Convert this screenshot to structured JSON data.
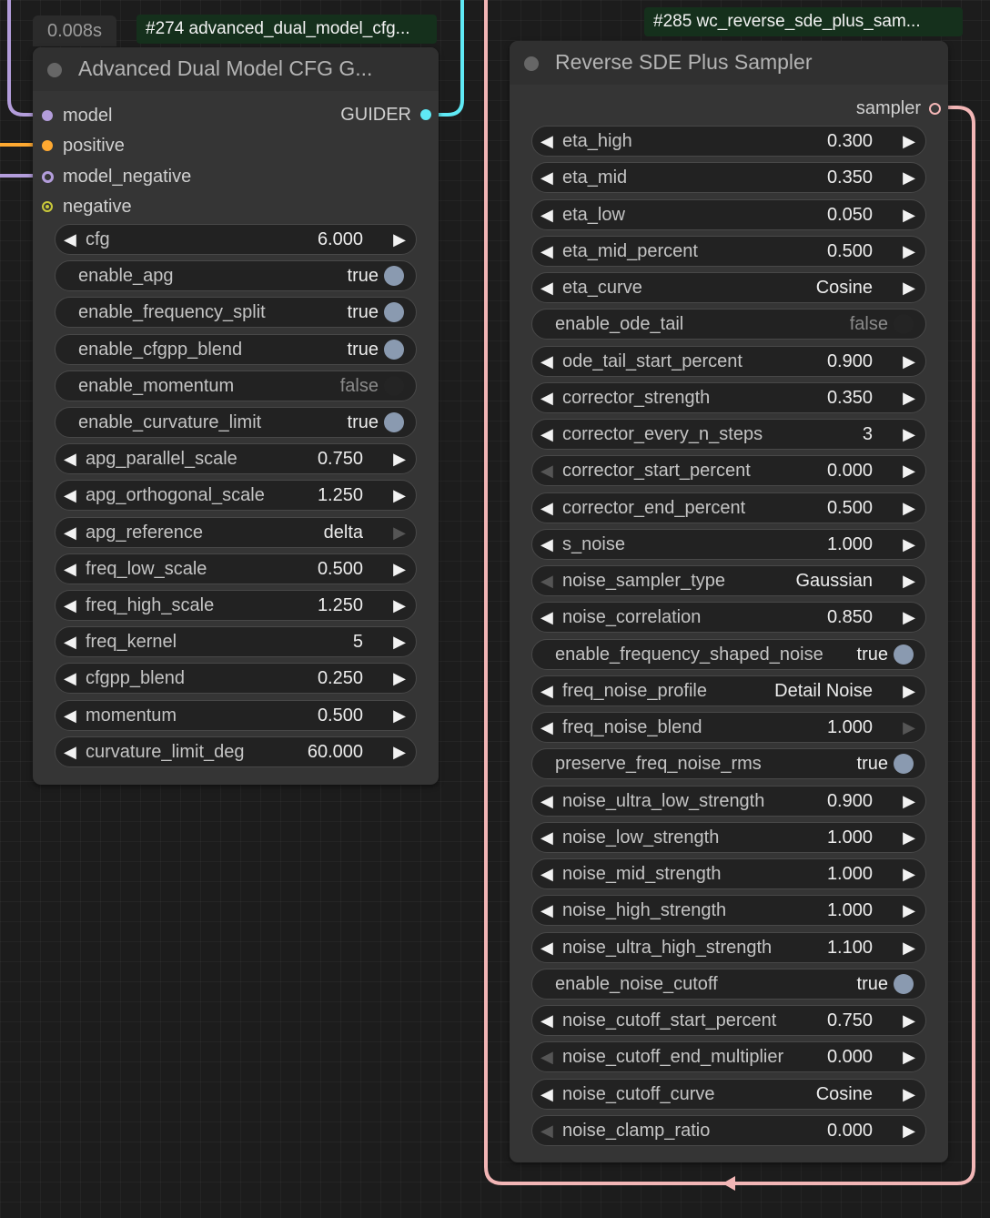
{
  "colors": {
    "model": "#b39ddb",
    "positive": "#ffa931",
    "negative": "#c9c93a",
    "guider": "#5fe9f5",
    "sampler": "#f3b6b6",
    "toggle_on": "#8a9ab0"
  },
  "left_node": {
    "exec_time": "0.008s",
    "id_label": "#274 advanced_dual_model_cfg...",
    "title": "Advanced Dual Model CFG G...",
    "inputs": [
      {
        "label": "model",
        "type": "model"
      },
      {
        "label": "positive",
        "type": "positive"
      },
      {
        "label": "model_negative",
        "type": "model"
      },
      {
        "label": "negative",
        "type": "negative"
      }
    ],
    "output": {
      "label": "GUIDER",
      "type": "guider"
    },
    "widgets": [
      {
        "kind": "num",
        "label": "cfg",
        "value": "6.000"
      },
      {
        "kind": "toggle",
        "label": "enable_apg",
        "value": "true",
        "on": true
      },
      {
        "kind": "toggle",
        "label": "enable_frequency_split",
        "value": "true",
        "on": true
      },
      {
        "kind": "toggle",
        "label": "enable_cfgpp_blend",
        "value": "true",
        "on": true
      },
      {
        "kind": "toggle",
        "label": "enable_momentum",
        "value": "false",
        "on": false
      },
      {
        "kind": "toggle",
        "label": "enable_curvature_limit",
        "value": "true",
        "on": true
      },
      {
        "kind": "num",
        "label": "apg_parallel_scale",
        "value": "0.750"
      },
      {
        "kind": "num",
        "label": "apg_orthogonal_scale",
        "value": "1.250"
      },
      {
        "kind": "combo",
        "label": "apg_reference",
        "value": "delta",
        "right_disabled": true
      },
      {
        "kind": "num",
        "label": "freq_low_scale",
        "value": "0.500"
      },
      {
        "kind": "num",
        "label": "freq_high_scale",
        "value": "1.250"
      },
      {
        "kind": "num",
        "label": "freq_kernel",
        "value": "5"
      },
      {
        "kind": "num",
        "label": "cfgpp_blend",
        "value": "0.250"
      },
      {
        "kind": "num",
        "label": "momentum",
        "value": "0.500"
      },
      {
        "kind": "num",
        "label": "curvature_limit_deg",
        "value": "60.000"
      }
    ]
  },
  "right_node": {
    "id_label": "#285 wc_reverse_sde_plus_sam...",
    "title": "Reverse SDE Plus Sampler",
    "output": {
      "label": "sampler",
      "type": "sampler"
    },
    "widgets": [
      {
        "kind": "num",
        "label": "eta_high",
        "value": "0.300"
      },
      {
        "kind": "num",
        "label": "eta_mid",
        "value": "0.350"
      },
      {
        "kind": "num",
        "label": "eta_low",
        "value": "0.050"
      },
      {
        "kind": "num",
        "label": "eta_mid_percent",
        "value": "0.500"
      },
      {
        "kind": "combo",
        "label": "eta_curve",
        "value": "Cosine"
      },
      {
        "kind": "toggle",
        "label": "enable_ode_tail",
        "value": "false",
        "on": false
      },
      {
        "kind": "num",
        "label": "ode_tail_start_percent",
        "value": "0.900"
      },
      {
        "kind": "num",
        "label": "corrector_strength",
        "value": "0.350"
      },
      {
        "kind": "num",
        "label": "corrector_every_n_steps",
        "value": "3"
      },
      {
        "kind": "num",
        "label": "corrector_start_percent",
        "value": "0.000",
        "left_disabled": true
      },
      {
        "kind": "num",
        "label": "corrector_end_percent",
        "value": "0.500"
      },
      {
        "kind": "num",
        "label": "s_noise",
        "value": "1.000"
      },
      {
        "kind": "combo",
        "label": "noise_sampler_type",
        "value": "Gaussian",
        "left_disabled": true
      },
      {
        "kind": "num",
        "label": "noise_correlation",
        "value": "0.850"
      },
      {
        "kind": "toggle",
        "label": "enable_frequency_shaped_noise",
        "value": "true",
        "on": true
      },
      {
        "kind": "combo",
        "label": "freq_noise_profile",
        "value": "Detail Noise"
      },
      {
        "kind": "num",
        "label": "freq_noise_blend",
        "value": "1.000",
        "right_disabled": true
      },
      {
        "kind": "toggle",
        "label": "preserve_freq_noise_rms",
        "value": "true",
        "on": true
      },
      {
        "kind": "num",
        "label": "noise_ultra_low_strength",
        "value": "0.900"
      },
      {
        "kind": "num",
        "label": "noise_low_strength",
        "value": "1.000"
      },
      {
        "kind": "num",
        "label": "noise_mid_strength",
        "value": "1.000"
      },
      {
        "kind": "num",
        "label": "noise_high_strength",
        "value": "1.000"
      },
      {
        "kind": "num",
        "label": "noise_ultra_high_strength",
        "value": "1.100"
      },
      {
        "kind": "toggle",
        "label": "enable_noise_cutoff",
        "value": "true",
        "on": true
      },
      {
        "kind": "num",
        "label": "noise_cutoff_start_percent",
        "value": "0.750"
      },
      {
        "kind": "num",
        "label": "noise_cutoff_end_multiplier",
        "value": "0.000",
        "left_disabled": true
      },
      {
        "kind": "combo",
        "label": "noise_cutoff_curve",
        "value": "Cosine"
      },
      {
        "kind": "num",
        "label": "noise_clamp_ratio",
        "value": "0.000",
        "left_disabled": true
      }
    ]
  }
}
